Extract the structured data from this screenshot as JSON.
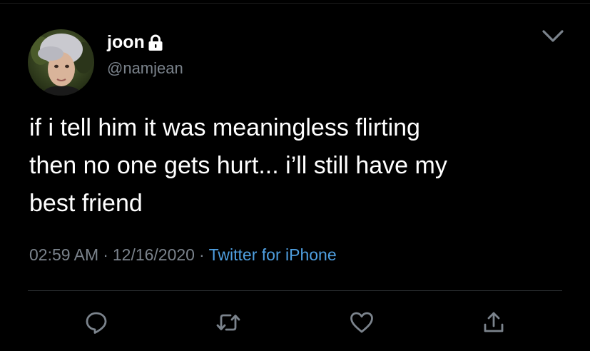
{
  "profile": {
    "display_name": "joon",
    "handle": "@namjean",
    "protected_icon": "lock-icon"
  },
  "menu": {
    "icon": "chevron-down-icon"
  },
  "tweet": {
    "text": "if i tell him it was meaningless flirting\nthen no one gets hurt... i’ll still have my\nbest friend"
  },
  "meta": {
    "time": "02:59 AM",
    "separator": "·",
    "date": "12/16/2020",
    "source": "Twitter for iPhone"
  },
  "actions": [
    {
      "icon": "reply-icon"
    },
    {
      "icon": "retweet-icon"
    },
    {
      "icon": "heart-icon"
    },
    {
      "icon": "share-icon"
    }
  ],
  "colors": {
    "background": "#000000",
    "text": "#ffffff",
    "secondary": "#7b838c",
    "accent": "#4f9fe0",
    "divider": "#2f3336"
  }
}
